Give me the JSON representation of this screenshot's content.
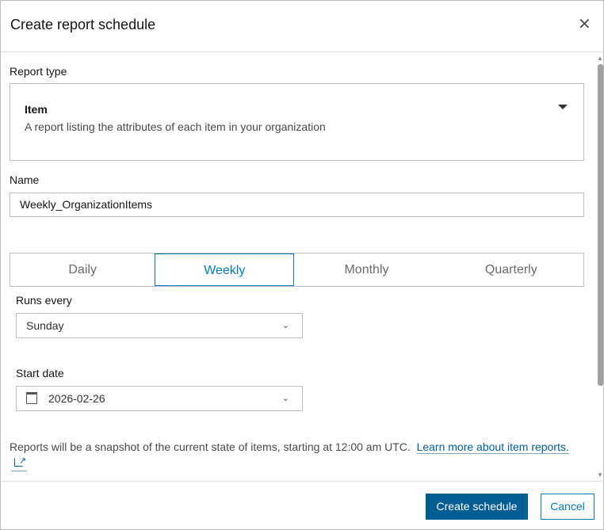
{
  "dialog": {
    "title": "Create report schedule",
    "close_icon": "close-icon"
  },
  "report_type": {
    "label": "Report type",
    "value": "Item",
    "description": "A report listing the attributes of each item in your organization"
  },
  "name": {
    "label": "Name",
    "value": "Weekly_OrganizationItems"
  },
  "frequency": {
    "tabs": [
      "Daily",
      "Weekly",
      "Monthly",
      "Quarterly"
    ],
    "selected": "Weekly"
  },
  "runs_every": {
    "label": "Runs every",
    "value": "Sunday"
  },
  "start_date": {
    "label": "Start date",
    "value": "2026-02-26"
  },
  "note": {
    "text": "Reports will be a snapshot of the current state of items, starting at 12:00 am UTC.",
    "link": "Learn more about item reports."
  },
  "footer": {
    "create_label": "Create schedule",
    "cancel_label": "Cancel"
  },
  "colors": {
    "accent": "#007ac2",
    "primary_button": "#005e95"
  }
}
